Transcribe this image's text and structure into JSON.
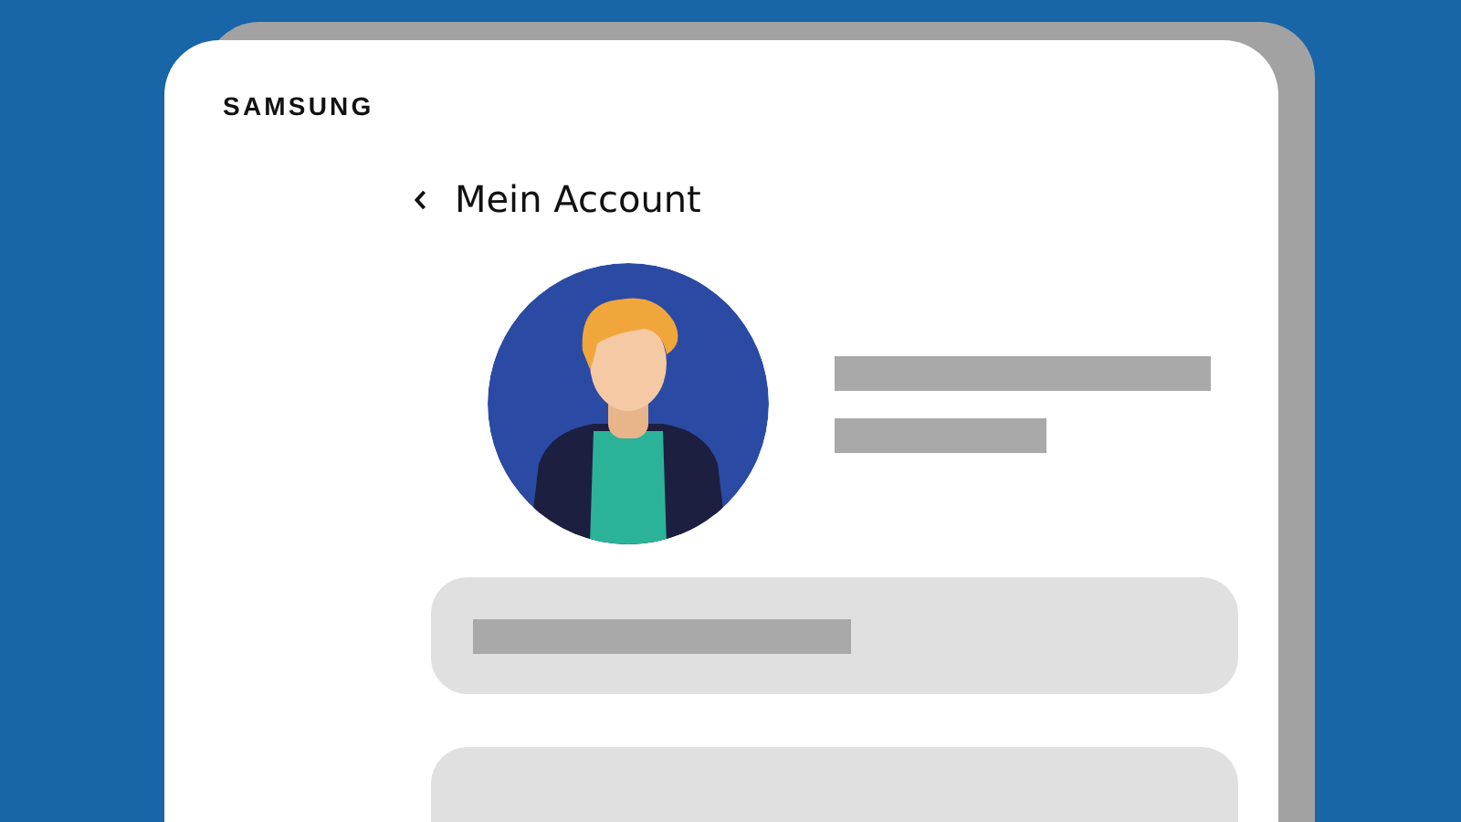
{
  "brand": "SAMSUNG",
  "header": {
    "title": "Mein Account"
  }
}
